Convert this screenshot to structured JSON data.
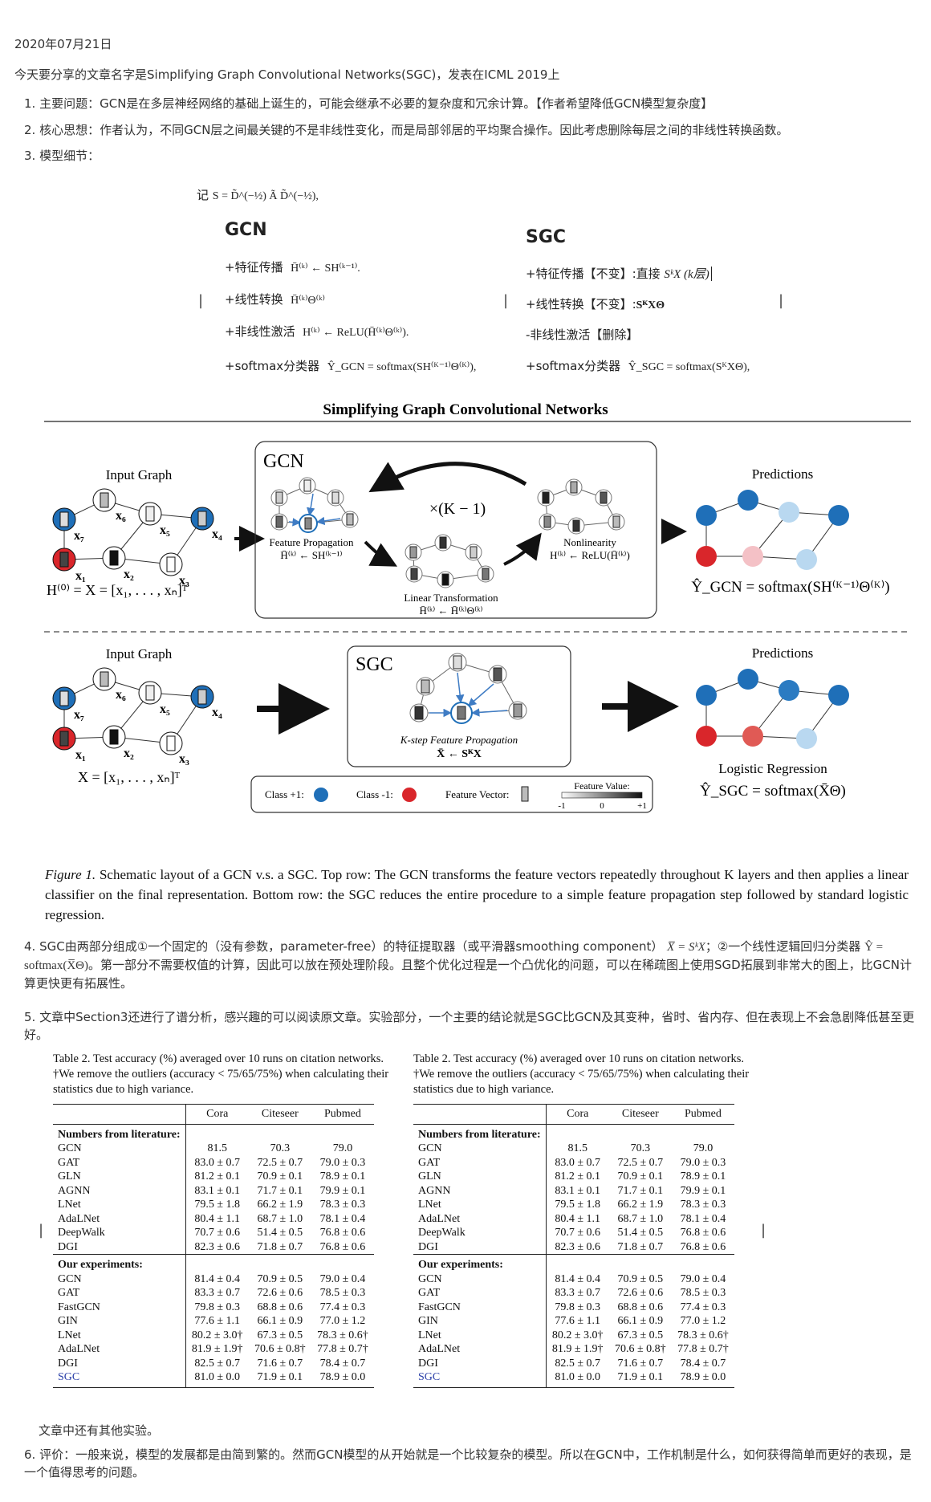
{
  "date": "2020年07月21日",
  "intro": "今天要分享的文章名字是Simplifying Graph Convolutional Networks(SGC)，发表在ICML 2019上",
  "items": [
    {
      "num": "1.",
      "text": "主要问题：GCN是在多层神经网络的基础上诞生的，可能会继承不必要的复杂度和冗余计算。【作者希望降低GCN模型复杂度】"
    },
    {
      "num": "2.",
      "text": "核心思想：作者认为，不同GCN层之间最关键的不是非线性变化，而是局部邻居的平均聚合操作。因此考虑删除每层之间的非线性转换函数。"
    },
    {
      "num": "3.",
      "text": "模型细节："
    },
    {
      "num": "4.",
      "text_a": "SGC由两部分组成①一个固定的（没有参数，parameter-free）的特征提取器（或平滑器smoothing component）",
      "formula_a": "X̅ = SᵏX",
      "text_b": "；②一个线性逻辑回归分类器",
      "formula_b": "Ŷ = softmax(X̅Θ)",
      "text_c": "。第一部分不需要权值的计算，因此可以放在预处理阶段。且整个优化过程是一个凸优化的问题，可以在稀疏图上使用SGD拓展到非常大的图上，比GCN计算更快更有拓展性。"
    },
    {
      "num": "5.",
      "text": "文章中Section3还进行了谱分析，感兴趣的可以阅读原文章。实验部分，一个主要的结论就是SGC比GCN及其变种，省时、省内存、但在表现上不会急剧降低甚至更好。"
    },
    {
      "num": "6.",
      "text": "评价：一般来说，模型的发展都是由简到繁的。然而GCN模型的从开始就是一个比较复杂的模型。所以在GCN中，工作机制是什么，如何获得简单而更好的表现，是一个值得思考的问题。"
    }
  ],
  "other_experiments": "文章中还有其他实验。",
  "model": {
    "note_label": "记",
    "note_formula": "S = D̃^(−½) Ã D̃^(−½),",
    "gcn": {
      "title": "GCN",
      "rows": [
        {
          "label": "+特征传播",
          "formula": "H̄⁽ᵏ⁾ ← SH⁽ᵏ⁻¹⁾."
        },
        {
          "label": "+线性转换",
          "formula": "H̄⁽ᵏ⁾Θ⁽ᵏ⁾"
        },
        {
          "label": "+非线性激活",
          "formula": "H⁽ᵏ⁾ ← ReLU(H̄⁽ᵏ⁾Θ⁽ᵏ⁾)."
        },
        {
          "label": "+softmax分类器",
          "formula": "Ŷ_GCN = softmax(SH⁽ᴷ⁻¹⁾Θ⁽ᴷ⁾),"
        }
      ]
    },
    "sgc": {
      "title": "SGC",
      "rows": [
        {
          "label": "+特征传播【不变】:直接",
          "formula": "SᵏX (k层)"
        },
        {
          "label": "+线性转换【不变】:",
          "formula": "SᴷXΘ"
        },
        {
          "label": "-非线性激活【删除】",
          "formula": ""
        },
        {
          "label": "+softmax分类器",
          "formula": "Ŷ_SGC = softmax(SᴷXΘ),"
        }
      ]
    }
  },
  "figure": {
    "title": "Simplifying Graph Convolutional Networks",
    "top": {
      "input_graph": "Input Graph",
      "h0": "H⁽⁰⁾ = X = [x₁, . . . , xₙ]ᵀ",
      "box_label": "GCN",
      "repeat": "×(K − 1)",
      "fp_label": "Feature Propagation",
      "fp_formula": "H̄⁽ᵏ⁾ ← SH⁽ᵏ⁻¹⁾",
      "lt_label": "Linear Transformation",
      "lt_formula": "H̄⁽ᵏ⁾ ← H̄⁽ᵏ⁾Θ⁽ᵏ⁾",
      "nl_label": "Nonlinearity",
      "nl_formula": "H⁽ᵏ⁾ ← ReLU(H̄⁽ᵏ⁾)",
      "predictions": "Predictions",
      "output": "Ŷ_GCN = softmax(SH⁽ᴷ⁻¹⁾Θ⁽ᴷ⁾)"
    },
    "bottom": {
      "input_graph": "Input Graph",
      "x": "X = [x₁, . . . , xₙ]ᵀ",
      "box_label": "SGC",
      "kfp_label": "K-step Feature Propagation",
      "kfp_formula": "X̄ ← SᴷX",
      "predictions": "Predictions",
      "lr_label": "Logistic Regression",
      "output": "Ŷ_SGC = softmax(X̄Θ)"
    },
    "node_labels": [
      "x₇",
      "x₆",
      "x₅",
      "x₄",
      "x₁",
      "x₂",
      "x₃"
    ],
    "legend": {
      "class_pos": "Class +1:",
      "class_neg": "Class -1:",
      "feature_vector": "Feature Vector:",
      "feature_value": "Feature Value:",
      "tick_min": "-1",
      "tick_mid": "0",
      "tick_max": "+1"
    },
    "caption_lead": "Figure 1.",
    "caption": " Schematic layout of a GCN v.s. a SGC. Top row: The GCN transforms the feature vectors repeatedly throughout K layers and then applies a linear classifier on the final representation. Bottom row: the SGC reduces the entire procedure to a simple feature propagation step followed by standard logistic regression."
  },
  "table": {
    "caption": "Table 2. Test accuracy (%) averaged over 10 runs on citation networks. †We remove the outliers (accuracy < 75/65/75%) when calculating their statistics due to high variance.",
    "columns": [
      "",
      "Cora",
      "Citeseer",
      "Pubmed"
    ],
    "section1": "Numbers from literature:",
    "rows1": [
      [
        "GCN",
        "81.5",
        "70.3",
        "79.0"
      ],
      [
        "GAT",
        "83.0 ± 0.7",
        "72.5 ± 0.7",
        "79.0 ± 0.3"
      ],
      [
        "GLN",
        "81.2 ± 0.1",
        "70.9 ± 0.1",
        "78.9 ± 0.1"
      ],
      [
        "AGNN",
        "83.1 ± 0.1",
        "71.7 ± 0.1",
        "79.9 ± 0.1"
      ],
      [
        "LNet",
        "79.5 ± 1.8",
        "66.2 ± 1.9",
        "78.3 ± 0.3"
      ],
      [
        "AdaLNet",
        "80.4 ± 1.1",
        "68.7 ± 1.0",
        "78.1 ± 0.4"
      ],
      [
        "DeepWalk",
        "70.7 ± 0.6",
        "51.4 ± 0.5",
        "76.8 ± 0.6"
      ],
      [
        "DGI",
        "82.3 ± 0.6",
        "71.8 ± 0.7",
        "76.8 ± 0.6"
      ]
    ],
    "section2": "Our experiments:",
    "rows2": [
      [
        "GCN",
        "81.4 ± 0.4",
        "70.9 ± 0.5",
        "79.0 ± 0.4"
      ],
      [
        "GAT",
        "83.3 ± 0.7",
        "72.6 ± 0.6",
        "78.5 ± 0.3"
      ],
      [
        "FastGCN",
        "79.8 ± 0.3",
        "68.8 ± 0.6",
        "77.4 ± 0.3"
      ],
      [
        "GIN",
        "77.6 ± 1.1",
        "66.1 ± 0.9",
        "77.0 ± 1.2"
      ],
      [
        "LNet",
        "80.2 ± 3.0†",
        "67.3 ± 0.5",
        "78.3 ± 0.6†"
      ],
      [
        "AdaLNet",
        "81.9 ± 1.9†",
        "70.6 ± 0.8†",
        "77.8 ± 0.7†"
      ],
      [
        "DGI",
        "82.5 ± 0.7",
        "71.6 ± 0.7",
        "78.4 ± 0.7"
      ],
      [
        "SGC",
        "81.0 ± 0.0",
        "71.9 ± 0.1",
        "78.9 ± 0.0"
      ]
    ]
  },
  "colors": {
    "class_pos": "#1f6fb8",
    "class_neg": "#d9262b",
    "sgc_row": "#2a3fa8"
  }
}
